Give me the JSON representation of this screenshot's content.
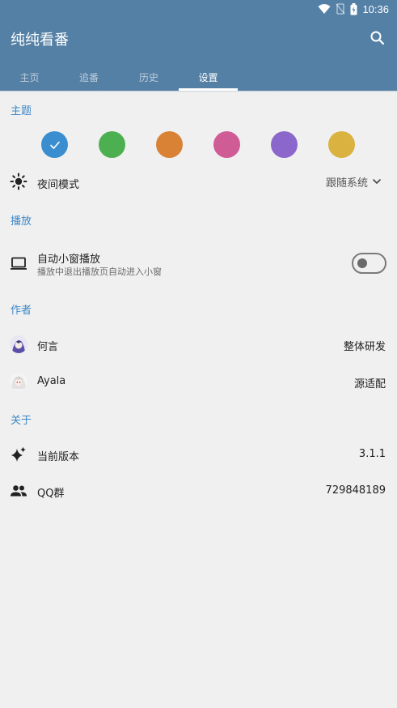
{
  "status": {
    "time": "10:36"
  },
  "app": {
    "title": "纯纯看番"
  },
  "tabs": [
    {
      "label": "主页"
    },
    {
      "label": "追番"
    },
    {
      "label": "历史"
    },
    {
      "label": "设置"
    }
  ],
  "theme": {
    "header": "主题",
    "colors": [
      "#3a8ed0",
      "#4caf50",
      "#d98235",
      "#d05c96",
      "#8b67cc",
      "#d9b23f"
    ],
    "selected": "#3a8ed0",
    "night_mode": {
      "label": "夜间模式",
      "value": "跟随系统"
    }
  },
  "playback": {
    "header": "播放",
    "auto_pip": {
      "label": "自动小窗播放",
      "description": "播放中退出播放页自动进入小窗",
      "enabled": false
    }
  },
  "authors": {
    "header": "作者",
    "items": [
      {
        "name": "何言",
        "role": "整体研发"
      },
      {
        "name": "Ayala",
        "role": "源适配"
      }
    ]
  },
  "about": {
    "header": "关于",
    "version": {
      "label": "当前版本",
      "value": "3.1.1"
    },
    "qq": {
      "label": "QQ群",
      "value": "729848189"
    }
  }
}
